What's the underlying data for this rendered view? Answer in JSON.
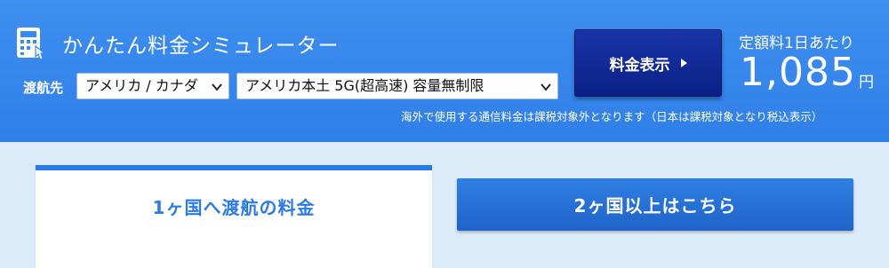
{
  "header": {
    "title": "かんたん料金シミュレーター",
    "destination_label": "渡航先",
    "country_select": {
      "value": "アメリカ / カナダ"
    },
    "plan_select": {
      "value": "アメリカ本土 5G(超高速) 容量無制限"
    },
    "show_price_button": "料金表示",
    "price": {
      "label": "定額料1日あたり",
      "value": "1,085",
      "unit": "円"
    },
    "tax_note": "海外で使用する通信料金は課税対象外となります（日本は課税対象となり税込表示）"
  },
  "tabs": [
    {
      "label": "1ヶ国へ渡航の料金",
      "active": true
    },
    {
      "label": "2ヶ国以上はこちら",
      "active": false
    }
  ],
  "icons": {
    "calculator": "calculator-icon",
    "dropdown": "chevron-down-icon",
    "play": "play-icon"
  },
  "colors": {
    "header_bg": "#3a8bee",
    "button_dark": "#0f258f",
    "tab_accent": "#2a7be6",
    "page_bg": "#dcebf9"
  }
}
